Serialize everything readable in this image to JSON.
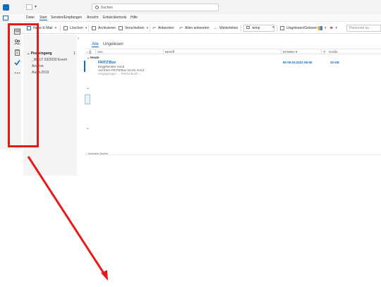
{
  "titlebar": {
    "search_placeholder": "Suchen",
    "quick_access": [
      "save-icon",
      "undo-icon"
    ],
    "colors": {
      "accent": "#0f6cbd",
      "bar": "#f3f3f3"
    }
  },
  "menu": {
    "items": [
      "Datei",
      "Start",
      "Senden/Empfangen",
      "Ansicht",
      "Entwicklertools",
      "Hilfe"
    ],
    "active": "Start"
  },
  "ribbon": {
    "new_mail": "Neue E-Mail",
    "delete": "Löschen",
    "archive": "Archivieren",
    "move": "Verschieben",
    "reply": "Antworten",
    "reply_all": "Allen antworten",
    "forward": "Weiterleiten",
    "quick_step": "temp",
    "unread_read": "Ungelesen/Gelesen",
    "people_search": "Personen su"
  },
  "rail": {
    "icons": [
      "calendar-icon",
      "people-icon",
      "tasks-icon",
      "checkmark-icon",
      "more-icon"
    ]
  },
  "folders": {
    "header": "Posteingang",
    "header_count": "1",
    "items": [
      "_WELT 03/2020 Event",
      "Archive",
      "Ausw.2019"
    ],
    "collapse_glyph": "‹"
  },
  "list": {
    "tabs": [
      "Alle",
      "Ungelesen"
    ],
    "columns": [
      "Von",
      "Betreff",
      "Erhalten",
      "Größe"
    ],
    "group_today": "Heute",
    "group_last_week": "Vorletzte Woche",
    "message": {
      "sender": "FRITZ!Box",
      "line1": "Eingehender Anruf",
      "line2": "Auf Ihrer FRITZ!Box ist ein Anruf",
      "line3": "eingegangen ... Telefonbuch ...",
      "date": "Mi 09.03.2022 09:06",
      "size": "20 KB"
    }
  },
  "annotation": {
    "color": "#e51b1b"
  }
}
